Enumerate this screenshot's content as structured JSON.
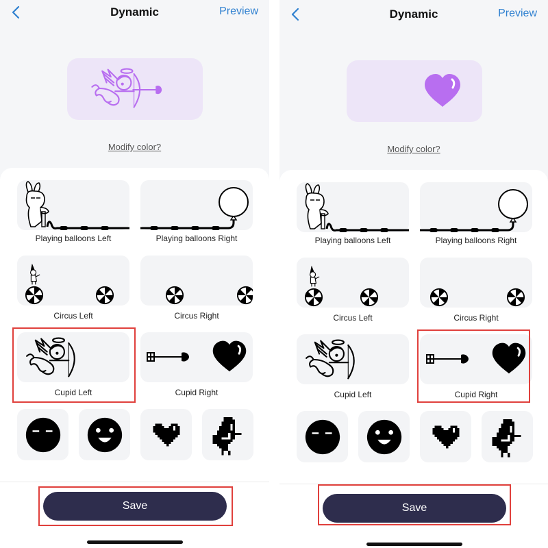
{
  "screens": [
    {
      "nav": {
        "back_icon": "chevron-left-icon",
        "title": "Dynamic",
        "preview_label": "Preview"
      },
      "preview": {
        "icon": "cupid-icon",
        "color": "#b86ef0",
        "background": "#ede5f8"
      },
      "modify_color_label": "Modify color?",
      "tiles": [
        {
          "label": "Playing balloons Left",
          "icon": "bunny-pump-icon"
        },
        {
          "label": "Playing balloons Right",
          "icon": "balloon-icon"
        },
        {
          "label": "Circus Left",
          "icon": "clown-ball-icon"
        },
        {
          "label": "Circus Right",
          "icon": "circus-ball-icon"
        },
        {
          "label": "Cupid Left",
          "icon": "cupid-icon"
        },
        {
          "label": "Cupid Right",
          "icon": "arrow-heart-icon"
        }
      ],
      "selected_tile": "Cupid Left",
      "small_tiles": [
        {
          "icon": "sleepy-face-icon"
        },
        {
          "icon": "smiley-face-icon"
        },
        {
          "icon": "pixel-heart-icon"
        },
        {
          "icon": "pixel-bird-icon"
        }
      ],
      "save_label": "Save"
    },
    {
      "nav": {
        "back_icon": "chevron-left-icon",
        "title": "Dynamic",
        "preview_label": "Preview"
      },
      "preview": {
        "icon": "heart-icon",
        "color": "#b86ef0",
        "background": "#ede5f8"
      },
      "modify_color_label": "Modify color?",
      "tiles": [
        {
          "label": "Playing balloons Left",
          "icon": "bunny-pump-icon"
        },
        {
          "label": "Playing balloons Right",
          "icon": "balloon-icon"
        },
        {
          "label": "Circus Left",
          "icon": "clown-ball-icon"
        },
        {
          "label": "Circus Right",
          "icon": "circus-ball-icon"
        },
        {
          "label": "Cupid Left",
          "icon": "cupid-icon"
        },
        {
          "label": "Cupid Right",
          "icon": "arrow-heart-icon"
        }
      ],
      "selected_tile": "Cupid Right",
      "small_tiles": [
        {
          "icon": "sleepy-face-icon"
        },
        {
          "icon": "smiley-face-icon"
        },
        {
          "icon": "pixel-heart-icon"
        },
        {
          "icon": "pixel-bird-icon"
        }
      ],
      "save_label": "Save"
    }
  ],
  "colors": {
    "accent": "#2f80d0",
    "highlight": "#e0403c",
    "save_button": "#2e2d4d",
    "preview_icon": "#b86ef0"
  }
}
